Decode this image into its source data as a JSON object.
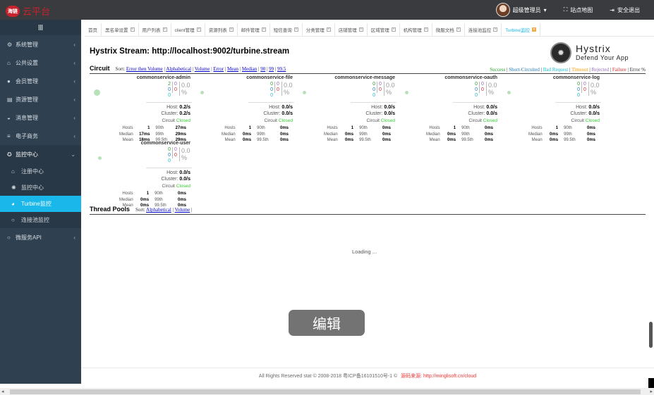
{
  "header": {
    "logo_badge": "海链",
    "logo_text": "云平台",
    "user_name": "超级管理员",
    "site_map": "站点地图",
    "logout": "安全退出"
  },
  "sidebar": {
    "toggle_icon": "menu-icon",
    "items": [
      {
        "label": "系统管理",
        "icon": "gears-icon"
      },
      {
        "label": "公共设置",
        "icon": "bank-icon"
      },
      {
        "label": "会员管理",
        "icon": "user-icon"
      },
      {
        "label": "资源管理",
        "icon": "file-icon"
      },
      {
        "label": "消息管理",
        "icon": "car-icon"
      },
      {
        "label": "电子商务",
        "icon": "sliders-icon"
      },
      {
        "label": "监控中心",
        "icon": "gear-icon"
      }
    ],
    "sub_items": [
      {
        "label": "注册中心",
        "icon": "bank-icon"
      },
      {
        "label": "监控中心",
        "icon": "spinner-icon"
      },
      {
        "label": "Turbine监控",
        "icon": "pie-icon"
      },
      {
        "label": "连接池监控",
        "icon": "circle-icon"
      }
    ],
    "last_item": {
      "label": "微服务API",
      "icon": "circle-icon"
    }
  },
  "tabs": [
    "首页",
    "黑名单设置",
    "用户列表",
    "client管理",
    "资源列表",
    "邮件管理",
    "短信查询",
    "分类管理",
    "店铺管理",
    "区域管理",
    "机构管理",
    "微服文档",
    "连接池监控",
    "Turbine监控"
  ],
  "hystrix": {
    "title": "Hystrix Stream: http://localhost:9002/turbine.stream",
    "logo_name": "Hystrix",
    "logo_tagline": "Defend Your App"
  },
  "circuit": {
    "label": "Circuit",
    "sort_prefix": "Sort:",
    "sort_links": [
      "Error then Volume",
      "Alphabetical",
      "Volume",
      "Error",
      "Mean",
      "Median",
      "90",
      "99",
      "99.5"
    ],
    "legend": [
      {
        "text": "Success",
        "color": "#2ca02c"
      },
      {
        "text": "Short-Circuited",
        "color": "#1f77b4"
      },
      {
        "text": "Bad Request",
        "color": "#17becf"
      },
      {
        "text": "Timeout",
        "color": "#ff9900"
      },
      {
        "text": "Rejected",
        "color": "#9467bd"
      },
      {
        "text": "Failure",
        "color": "#d62728"
      },
      {
        "text": "Error %",
        "color": "#333333"
      }
    ],
    "boxes": [
      {
        "name": "commonservice-admin",
        "c1": [
          "2",
          "0",
          "0"
        ],
        "c2": [
          "0",
          "0"
        ],
        "pct": "0.0 %",
        "host": "0.2/s",
        "cluster": "0.2/s",
        "circuit_label": "Circuit",
        "circuit": "Closed",
        "stats": [
          [
            "Hosts",
            "1",
            "90th",
            "27ms"
          ],
          [
            "Median",
            "17ms",
            "99th",
            "29ms"
          ],
          [
            "Mean",
            "18ms",
            "99.5th",
            "29ms"
          ]
        ]
      },
      {
        "name": "commonservice-file",
        "c1": [
          "0",
          "0",
          "0"
        ],
        "c2": [
          "0",
          "0"
        ],
        "pct": "0.0 %",
        "host": "0.0/s",
        "cluster": "0.0/s",
        "circuit_label": "Circuit",
        "circuit": "Closed",
        "stats": [
          [
            "Hosts",
            "1",
            "90th",
            "0ms"
          ],
          [
            "Median",
            "0ms",
            "99th",
            "0ms"
          ],
          [
            "Mean",
            "0ms",
            "99.5th",
            "0ms"
          ]
        ]
      },
      {
        "name": "commonservice-message",
        "c1": [
          "0",
          "0",
          "0"
        ],
        "c2": [
          "0",
          "0"
        ],
        "pct": "0.0 %",
        "host": "0.0/s",
        "cluster": "0.0/s",
        "circuit_label": "Circuit",
        "circuit": "Closed",
        "stats": [
          [
            "Hosts",
            "1",
            "90th",
            "0ms"
          ],
          [
            "Median",
            "0ms",
            "99th",
            "0ms"
          ],
          [
            "Mean",
            "0ms",
            "99.5th",
            "0ms"
          ]
        ]
      },
      {
        "name": "commonservice-oauth",
        "c1": [
          "0",
          "0",
          "0"
        ],
        "c2": [
          "0",
          "0"
        ],
        "pct": "0.0 %",
        "host": "0.0/s",
        "cluster": "0.0/s",
        "circuit_label": "Circuit",
        "circuit": "Closed",
        "stats": [
          [
            "Hosts",
            "1",
            "90th",
            "0ms"
          ],
          [
            "Median",
            "0ms",
            "99th",
            "0ms"
          ],
          [
            "Mean",
            "0ms",
            "99.5th",
            "0ms"
          ]
        ]
      },
      {
        "name": "commonservice-log",
        "c1": [
          "0",
          "0",
          "0"
        ],
        "c2": [
          "0",
          "0"
        ],
        "pct": "0.0 %",
        "host": "0.0/s",
        "cluster": "0.0/s",
        "circuit_label": "Circuit",
        "circuit": "Closed",
        "stats": [
          [
            "Hosts",
            "1",
            "90th",
            "0ms"
          ],
          [
            "Median",
            "0ms",
            "99th",
            "0ms"
          ],
          [
            "Mean",
            "0ms",
            "99.5th",
            "0ms"
          ]
        ]
      },
      {
        "name": "commonservice-user",
        "c1": [
          "0",
          "0",
          "0"
        ],
        "c2": [
          "0",
          "0"
        ],
        "pct": "0.0 %",
        "host": "0.0/s",
        "cluster": "0.0/s",
        "circuit_label": "Circuit",
        "circuit": "Closed",
        "stats": [
          [
            "Hosts",
            "1",
            "90th",
            "0ms"
          ],
          [
            "Median",
            "0ms",
            "99th",
            "0ms"
          ],
          [
            "Mean",
            "0ms",
            "99.5th",
            "0ms"
          ]
        ]
      }
    ],
    "host_label": "Host:",
    "cluster_label": "Cluster:"
  },
  "thread_pools": {
    "label": "Thread Pools",
    "sort_prefix": "Sort:",
    "sort_links": [
      "Alphabetical",
      "Volume"
    ],
    "loading": "Loading ..."
  },
  "edit_button": "编辑",
  "footer": {
    "text": "All Rights Reserved stat © 2008-2018 粤ICP备16101510号-1 ©",
    "source_label": "源码来源:",
    "source_url": "http://minglisoft.cn/cloud"
  }
}
